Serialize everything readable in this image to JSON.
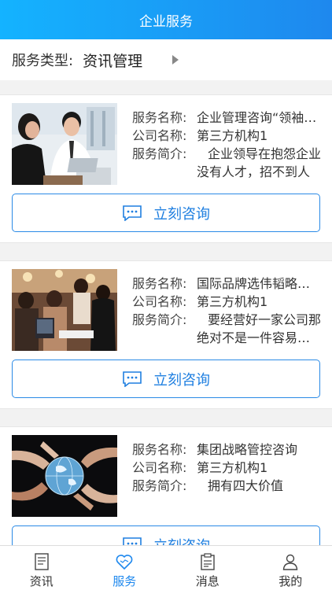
{
  "header": {
    "title": "企业服务"
  },
  "filter": {
    "label": "服务类型:",
    "value": "资讯管理"
  },
  "labels": {
    "name": "服务名称:",
    "company": "公司名称:",
    "intro": "服务简介:"
  },
  "cards": [
    {
      "name": "企业管理咨询“领袖智慧”",
      "company": "第三方机构1",
      "intro": "企业领导在抱怨企业没有人才，招不到人",
      "button": "立刻咨询"
    },
    {
      "name": "国际品牌选伟韬略管理咨询",
      "company": "第三方机构1",
      "intro": "要经营好一家公司那绝对不是一件容易的事",
      "button": "立刻咨询"
    },
    {
      "name": "集团战略管控咨询",
      "company": "第三方机构1",
      "intro": "拥有四大价值",
      "button": "立刻咨询"
    }
  ],
  "tabs": [
    {
      "label": "资讯",
      "icon": "news-icon"
    },
    {
      "label": "服务",
      "icon": "heart-icon"
    },
    {
      "label": "消息",
      "icon": "clipboard-icon"
    },
    {
      "label": "我的",
      "icon": "user-icon"
    }
  ],
  "colors": {
    "accent": "#1e88ee",
    "header_start": "#14b3ff",
    "header_end": "#1e88ee"
  }
}
